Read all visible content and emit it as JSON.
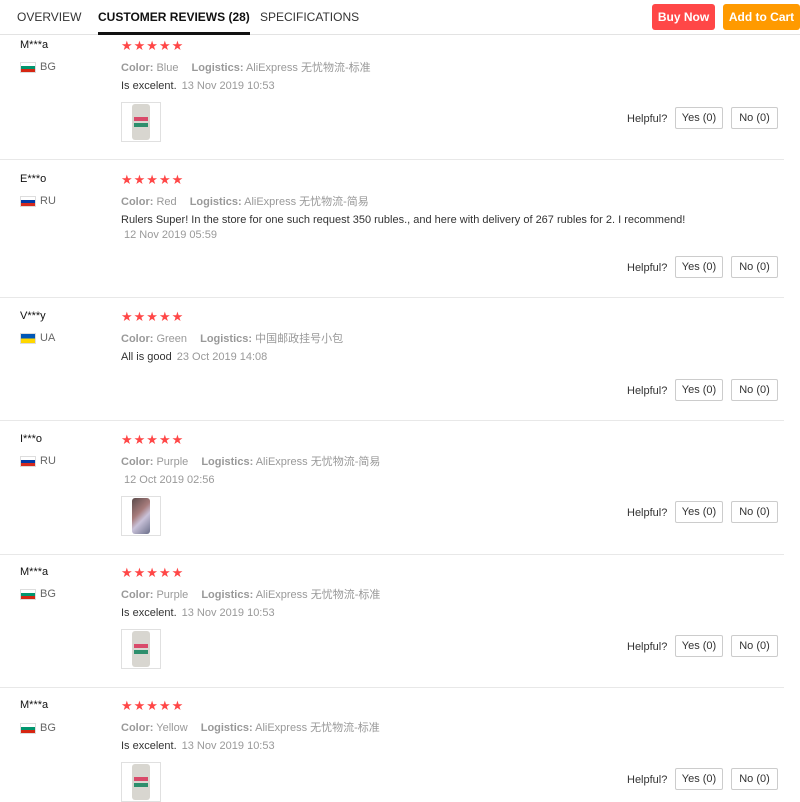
{
  "tabs": [
    {
      "label": "OVERVIEW"
    },
    {
      "label": "CUSTOMER REVIEWS (28)"
    },
    {
      "label": "SPECIFICATIONS"
    }
  ],
  "actions": {
    "buy_now": "Buy Now",
    "add_to_cart": "Add to Cart"
  },
  "labels": {
    "color": "Color:",
    "logistics": "Logistics:",
    "helpful": "Helpful?"
  },
  "stars": "★★★★★",
  "reviews": [
    {
      "user": "M***a",
      "country": "BG",
      "color": "Blue",
      "logistics": "AliExpress 无忧物流-标准",
      "text": "Is excelent.",
      "date": "13 Nov 2019 10:53",
      "yes": "Yes (0)",
      "no": "No (0)"
    },
    {
      "user": "E***o",
      "country": "RU",
      "color": "Red",
      "logistics": "AliExpress 无忧物流-简易",
      "text": "Rulers Super! In the store for one such request 350 rubles., and here with delivery of 267 rubles for 2. I recommend!",
      "date": "12 Nov 2019 05:59",
      "yes": "Yes (0)",
      "no": "No (0)"
    },
    {
      "user": "V***y",
      "country": "UA",
      "color": "Green",
      "logistics": "中国邮政挂号小包",
      "text": "All is good",
      "date": "23 Oct 2019 14:08",
      "yes": "Yes (0)",
      "no": "No (0)"
    },
    {
      "user": "I***o",
      "country": "RU",
      "color": "Purple",
      "logistics": "AliExpress 无忧物流-简易",
      "text": "",
      "date": "12 Oct 2019 02:56",
      "yes": "Yes (0)",
      "no": "No (0)"
    },
    {
      "user": "M***a",
      "country": "BG",
      "color": "Purple",
      "logistics": "AliExpress 无忧物流-标准",
      "text": "Is excelent.",
      "date": "13 Nov 2019 10:53",
      "yes": "Yes (0)",
      "no": "No (0)"
    },
    {
      "user": "M***a",
      "country": "BG",
      "color": "Yellow",
      "logistics": "AliExpress 无忧物流-标准",
      "text": "Is excelent.",
      "date": "13 Nov 2019 10:53",
      "yes": "Yes (0)",
      "no": "No (0)"
    }
  ]
}
